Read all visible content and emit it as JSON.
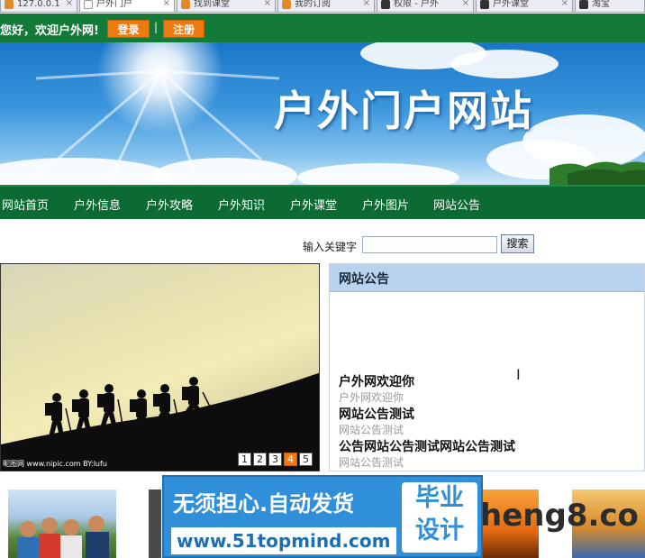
{
  "browser": {
    "tabs": [
      {
        "label": "127.0.0.1",
        "active": false
      },
      {
        "label": "户外门户",
        "active": true
      },
      {
        "label": "找到课堂",
        "active": false
      },
      {
        "label": "我的订阅",
        "active": false
      },
      {
        "label": "权限 - 户外",
        "active": false
      },
      {
        "label": "户外课堂",
        "active": false
      },
      {
        "label": "淘宝",
        "active": false
      }
    ]
  },
  "topbar": {
    "welcome": "您好，欢迎户外网!",
    "login": "登录",
    "separator": "|",
    "register": "注册"
  },
  "banner": {
    "title": "户外门户网站"
  },
  "nav": {
    "items": [
      "网站首页",
      "户外信息",
      "户外攻略",
      "户外知识",
      "户外课堂",
      "户外图片",
      "网站公告"
    ]
  },
  "search": {
    "label": "输入关键字",
    "value": "",
    "button": "搜索"
  },
  "slider": {
    "caption": "昵图网 www.nipic.com  BY:lufu",
    "pages": [
      "1",
      "2",
      "3",
      "4",
      "5"
    ],
    "active_page": "4"
  },
  "notice": {
    "title": "网站公告",
    "items": [
      {
        "title": "户外网欢迎你",
        "sub": "户外网欢迎你"
      },
      {
        "title": "网站公告测试",
        "sub": "网站公告测试"
      },
      {
        "title": "公告网站公告测试网站公告测试",
        "sub": "网站公告测试"
      }
    ]
  },
  "ad": {
    "line1": "无须担心.自动发货",
    "line2": "www.51topmind.com",
    "box_line1": "毕业",
    "box_line2": "设计"
  },
  "watermark": "heng8.co",
  "colors": {
    "header_green": "#137a3a",
    "nav_green": "#0b6b33",
    "button_orange": "#f07a12",
    "notice_header": "#b9d2ee",
    "ad_blue": "#2f8fd9"
  }
}
